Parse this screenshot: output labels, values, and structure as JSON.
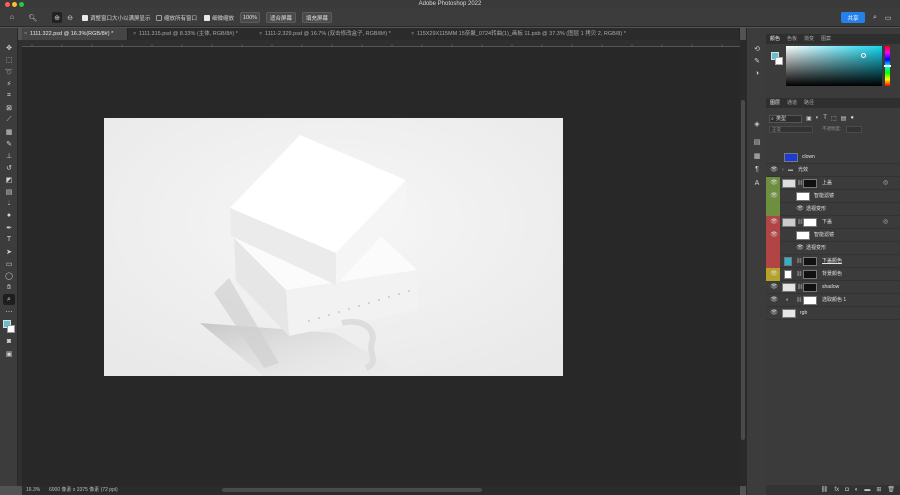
{
  "app": {
    "title": "Adobe Photoshop 2022"
  },
  "options": {
    "resize_windows_label": "调整窗口大小以满屏显示",
    "zoom_all_label": "缩放所有窗口",
    "scrubby_zoom_label": "细微缩放",
    "zoom_value": "100%",
    "fit_screen_label": "适合屏幕",
    "fill_screen_label": "填充屏幕",
    "share_label": "共享"
  },
  "tabs": [
    {
      "label": "1111.322.psd @ 16.3%(RGB/8#) *",
      "active": true
    },
    {
      "label": "1111.315.psd @ 8.33% (主体, RGB/8#) *"
    },
    {
      "label": "1111-2.329.psd @ 16.7% (双击修改盒子, RGB/8#) *"
    },
    {
      "label": "115X29X115MM  15奈聚_0724转曲(1)_画板 11.psb @ 37.3% (图层 1 拷贝 2, RGB/8) *"
    }
  ],
  "status": {
    "zoom": "16.3%",
    "doc_size": "6000 像素 x 3375 像素 (72 ppi)"
  },
  "color_panel": {
    "tabs": [
      "颜色",
      "色板",
      "渐变",
      "图案"
    ],
    "foreground": "#5fc3cf",
    "background": "#ffffff"
  },
  "layers_panel": {
    "tabs": [
      "图层",
      "通道",
      "路径"
    ],
    "kind_label": "类型",
    "mode_label": "正常",
    "opacity_label": "不透明度:",
    "layers": [
      {
        "name": "clown",
        "color": ""
      },
      {
        "name": "光效",
        "color": ""
      },
      {
        "name": "上盖",
        "color": "#6e8f3f"
      },
      {
        "name": "智能滤镜",
        "color": "#6e8f3f"
      },
      {
        "name": "透视变形",
        "color": "#6e8f3f"
      },
      {
        "name": "下盖",
        "color": "#b14545"
      },
      {
        "name": "智能滤镜",
        "color": "#b14545"
      },
      {
        "name": "透视变形",
        "color": "#b14545"
      },
      {
        "name": "下盖颜色",
        "color": "#b14545"
      },
      {
        "name": "背景颜色",
        "color": "#b5a228"
      },
      {
        "name": "shadow",
        "color": ""
      },
      {
        "name": "选取颜色 1",
        "color": ""
      },
      {
        "name": "rgb",
        "color": ""
      }
    ]
  }
}
